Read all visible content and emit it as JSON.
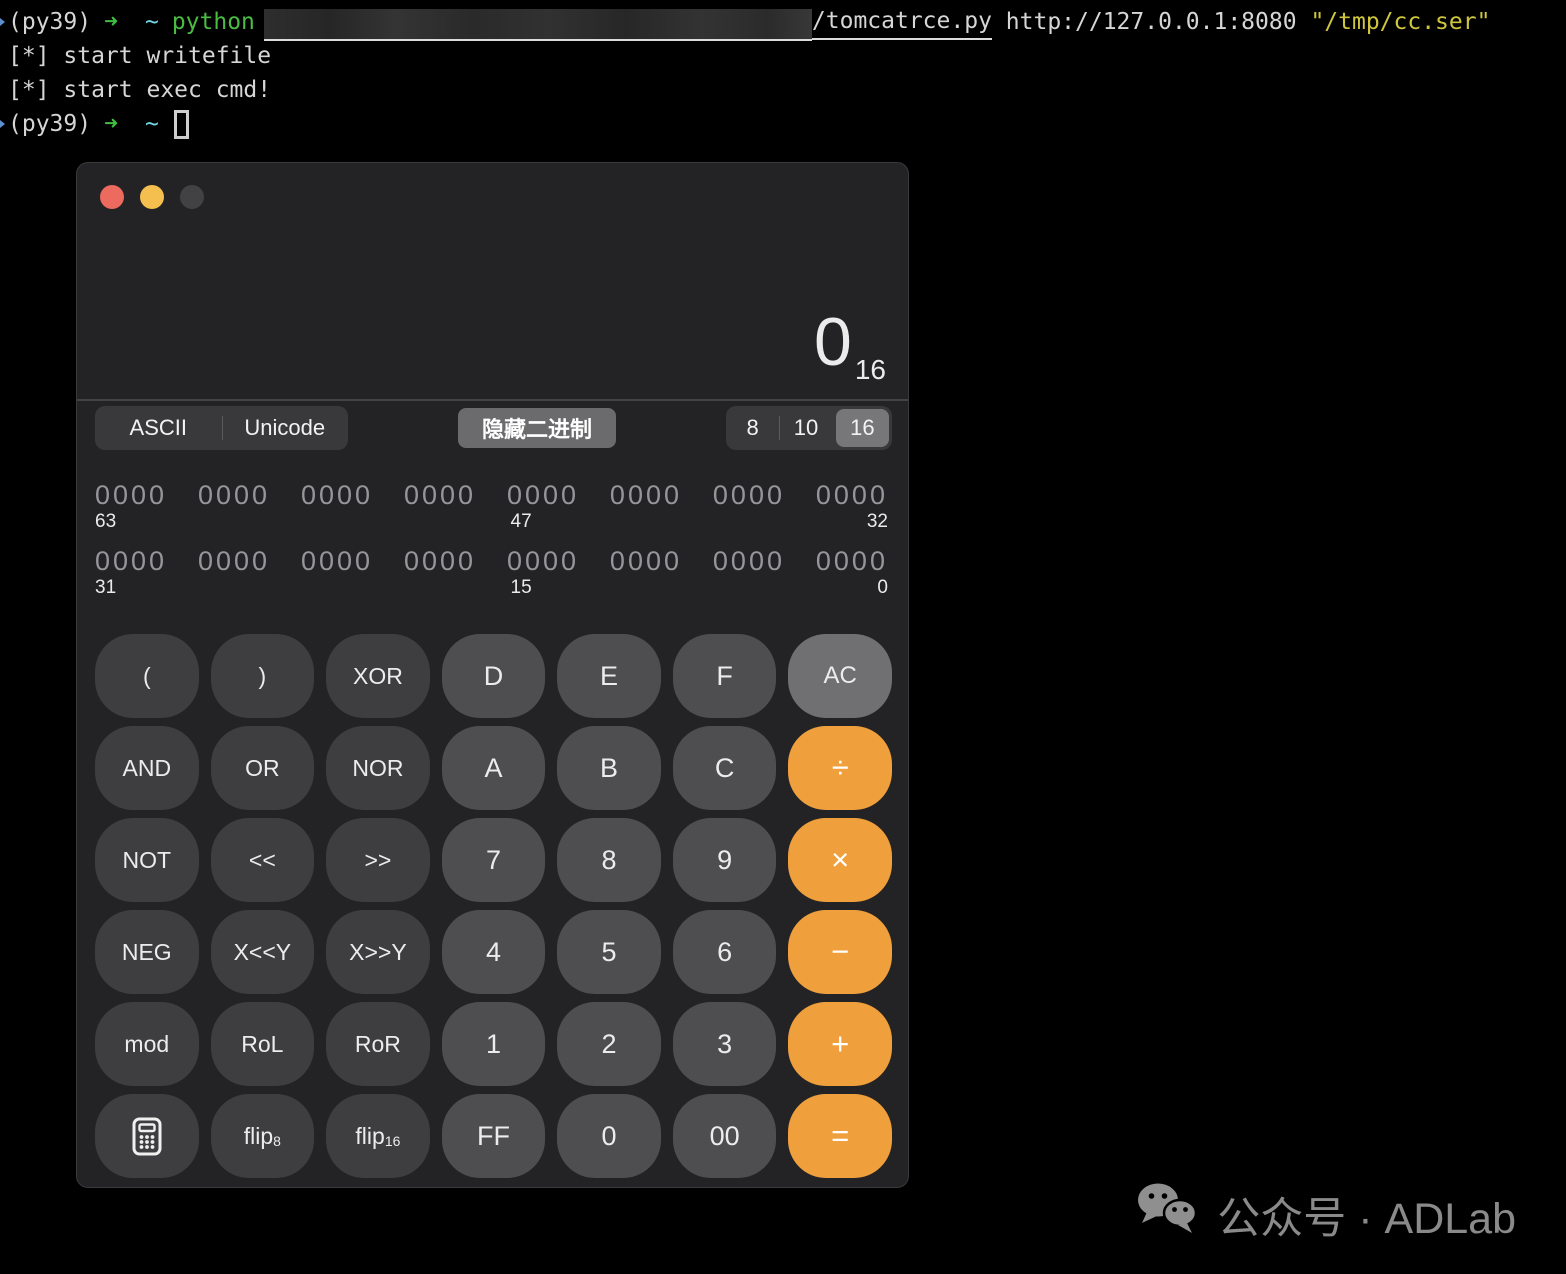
{
  "terminal": {
    "line1": {
      "env": "(py39)",
      "arrow": "➜",
      "dir": "~",
      "command": "python",
      "script": "/tomcatrce.py",
      "url": "http://127.0.0.1:8080",
      "arg": "\"/tmp/cc.ser\""
    },
    "line2": "[*] start writefile",
    "line3": "[*] start exec cmd!",
    "line4": {
      "env": "(py39)",
      "arrow": "➜",
      "dir": "~"
    }
  },
  "calculator": {
    "display": {
      "value": "0",
      "base_subscript": "16"
    },
    "controls": {
      "encoding_options": [
        {
          "label": "ASCII",
          "name": "segment-ascii",
          "selected": false
        },
        {
          "label": "Unicode",
          "name": "segment-unicode",
          "selected": false
        }
      ],
      "hide_binary_label": "隐藏二进制",
      "base_options": [
        {
          "label": "8",
          "name": "segment-base-8",
          "selected": false
        },
        {
          "label": "10",
          "name": "segment-base-10",
          "selected": false
        },
        {
          "label": "16",
          "name": "segment-base-16",
          "selected": true
        }
      ]
    },
    "binary": {
      "rows": [
        {
          "groups": [
            "0000",
            "0000",
            "0000",
            "0000",
            "0000",
            "0000",
            "0000",
            "0000"
          ],
          "label_left": "63",
          "label_mid": "47",
          "label_right": "32"
        },
        {
          "groups": [
            "0000",
            "0000",
            "0000",
            "0000",
            "0000",
            "0000",
            "0000",
            "0000"
          ],
          "label_left": "31",
          "label_mid": "15",
          "label_right": "0"
        }
      ]
    },
    "keypad": {
      "rows": [
        [
          {
            "label": "(",
            "name": "key-open-paren",
            "type": "fn"
          },
          {
            "label": ")",
            "name": "key-close-paren",
            "type": "fn"
          },
          {
            "label": "XOR",
            "name": "key-xor",
            "type": "fn"
          },
          {
            "label": "D",
            "name": "key-d",
            "type": "digit"
          },
          {
            "label": "E",
            "name": "key-e",
            "type": "digit"
          },
          {
            "label": "F",
            "name": "key-f",
            "type": "digit"
          },
          {
            "label": "AC",
            "name": "key-ac",
            "type": "ac"
          }
        ],
        [
          {
            "label": "AND",
            "name": "key-and",
            "type": "fn"
          },
          {
            "label": "OR",
            "name": "key-or",
            "type": "fn"
          },
          {
            "label": "NOR",
            "name": "key-nor",
            "type": "fn"
          },
          {
            "label": "A",
            "name": "key-a",
            "type": "digit"
          },
          {
            "label": "B",
            "name": "key-b",
            "type": "digit"
          },
          {
            "label": "C",
            "name": "key-c",
            "type": "digit"
          },
          {
            "label": "÷",
            "name": "key-divide",
            "type": "op"
          }
        ],
        [
          {
            "label": "NOT",
            "name": "key-not",
            "type": "fn"
          },
          {
            "label": "<<",
            "name": "key-shift-left",
            "type": "fn"
          },
          {
            "label": ">>",
            "name": "key-shift-right",
            "type": "fn"
          },
          {
            "label": "7",
            "name": "key-7",
            "type": "digit"
          },
          {
            "label": "8",
            "name": "key-8",
            "type": "digit"
          },
          {
            "label": "9",
            "name": "key-9",
            "type": "digit"
          },
          {
            "label": "×",
            "name": "key-multiply",
            "type": "op"
          }
        ],
        [
          {
            "label": "NEG",
            "name": "key-neg",
            "type": "fn"
          },
          {
            "label": "X<<Y",
            "name": "key-x-shift-left-y",
            "type": "fn"
          },
          {
            "label": "X>>Y",
            "name": "key-x-shift-right-y",
            "type": "fn"
          },
          {
            "label": "4",
            "name": "key-4",
            "type": "digit"
          },
          {
            "label": "5",
            "name": "key-5",
            "type": "digit"
          },
          {
            "label": "6",
            "name": "key-6",
            "type": "digit"
          },
          {
            "label": "−",
            "name": "key-subtract",
            "type": "op"
          }
        ],
        [
          {
            "label": "mod",
            "name": "key-mod",
            "type": "fn"
          },
          {
            "label": "RoL",
            "name": "key-rol",
            "type": "fn"
          },
          {
            "label": "RoR",
            "name": "key-ror",
            "type": "fn"
          },
          {
            "label": "1",
            "name": "key-1",
            "type": "digit"
          },
          {
            "label": "2",
            "name": "key-2",
            "type": "digit"
          },
          {
            "label": "3",
            "name": "key-3",
            "type": "digit"
          },
          {
            "label": "+",
            "name": "key-add",
            "type": "op"
          }
        ],
        [
          {
            "icon": "calculator-icon",
            "name": "key-show-basic",
            "type": "fn"
          },
          {
            "label": "flip",
            "sub": "8",
            "name": "key-flip8",
            "type": "fn"
          },
          {
            "label": "flip",
            "sub": "16",
            "name": "key-flip16",
            "type": "fn"
          },
          {
            "label": "FF",
            "name": "key-ff",
            "type": "digit"
          },
          {
            "label": "0",
            "name": "key-0",
            "type": "digit"
          },
          {
            "label": "00",
            "name": "key-00",
            "type": "digit"
          },
          {
            "label": "=",
            "name": "key-equals",
            "type": "op"
          }
        ]
      ]
    }
  },
  "watermark": {
    "text": "公众号 · ADLab"
  },
  "colors": {
    "accent_orange": "#ef9f3c",
    "key_function": "#3e3e40",
    "key_digit": "#4e4e50",
    "key_ac": "#707072",
    "window_bg": "#232325",
    "traffic_close": "#ec6a5e",
    "traffic_min": "#f4bf4f",
    "terminal_green": "#4abc42",
    "terminal_cyan": "#72d7e4",
    "terminal_yellow": "#cfc63e"
  }
}
